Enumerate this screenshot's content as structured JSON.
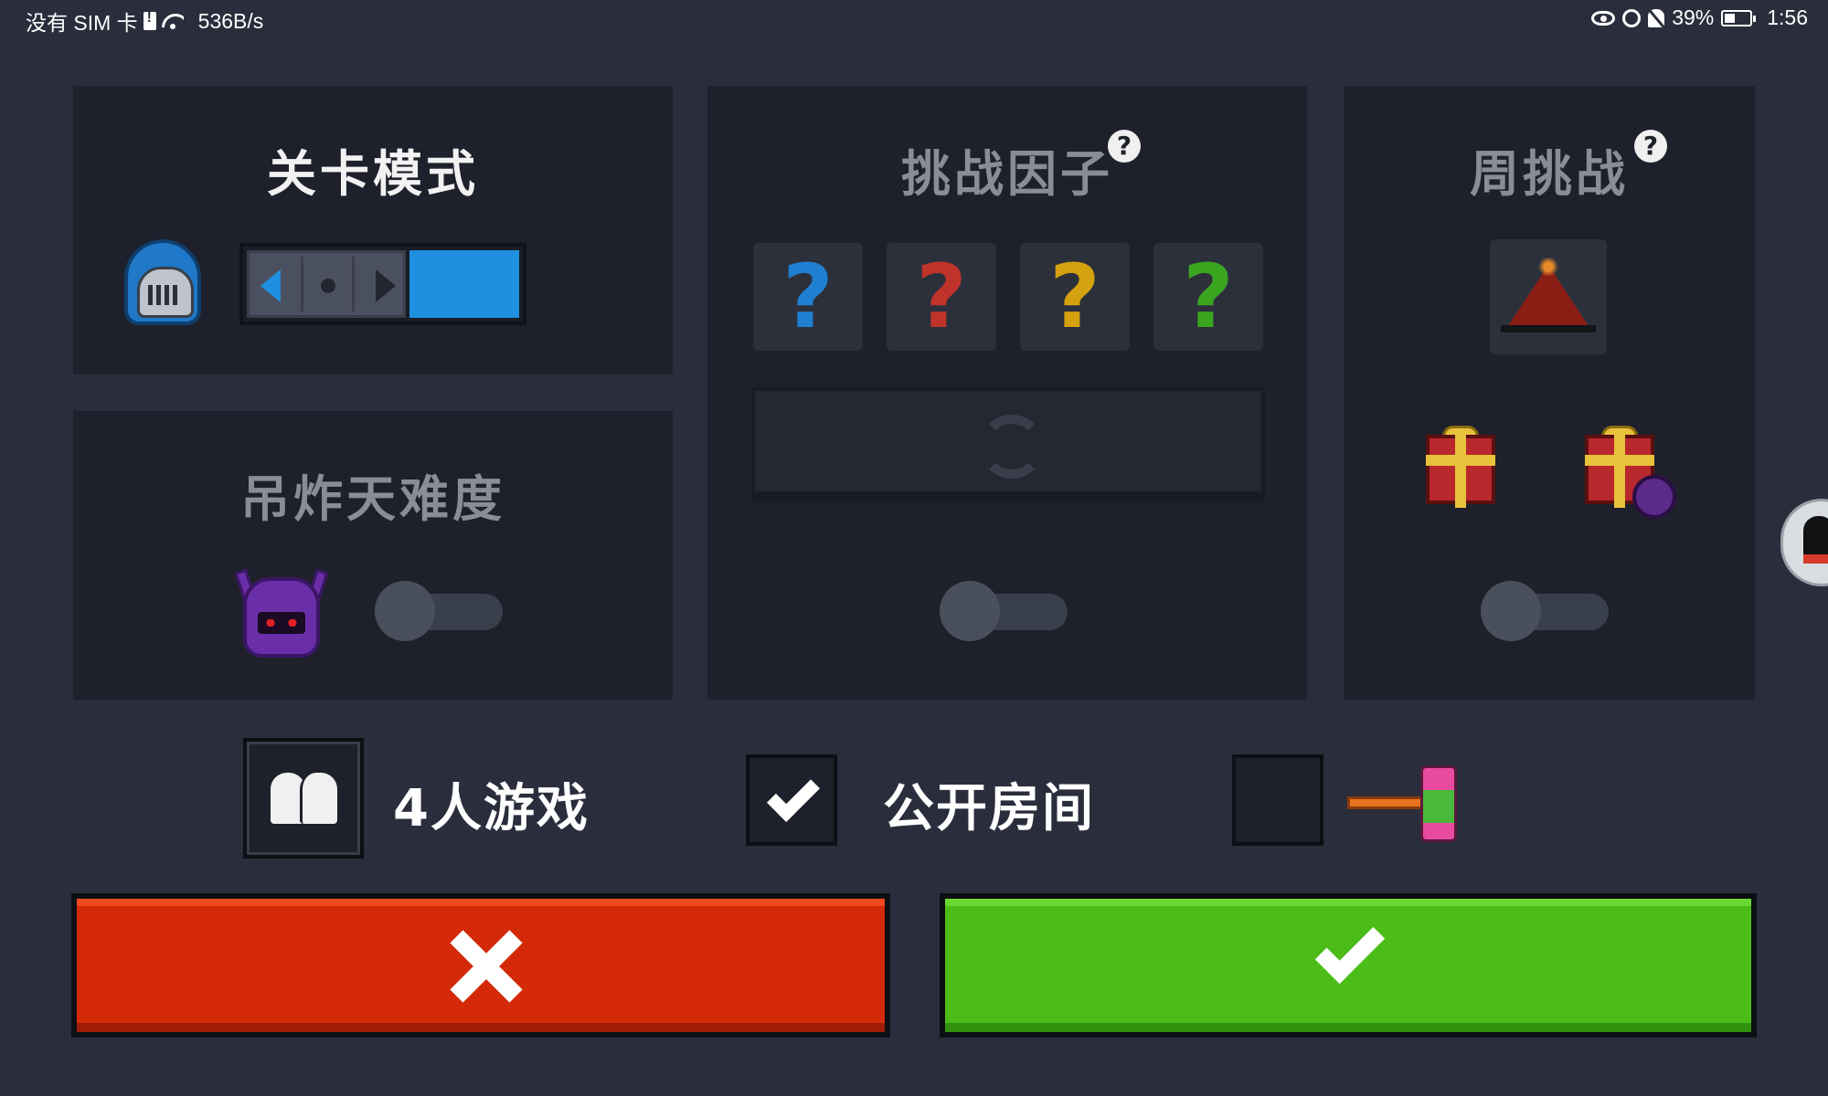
{
  "status_bar": {
    "carrier": "没有 SIM 卡",
    "net_speed": "536B/s",
    "battery": "39%",
    "time": "1:56",
    "icons": [
      "sim-alert-icon",
      "wifi-icon",
      "eye-icon",
      "alarm-icon",
      "bell-off-icon",
      "battery-charging-icon"
    ]
  },
  "level_mode": {
    "title": "关卡模式",
    "icon": "knight-helmet-icon"
  },
  "difficulty": {
    "title": "吊炸天难度",
    "icon": "demon-helmet-icon",
    "enabled": false
  },
  "challenge_factors": {
    "title": "挑战因子",
    "help": "?",
    "slots": [
      {
        "label": "?",
        "color": "#1f7fd0"
      },
      {
        "label": "?",
        "color": "#c0332a"
      },
      {
        "label": "?",
        "color": "#d4a10f"
      },
      {
        "label": "?",
        "color": "#3aa620"
      }
    ],
    "refresh_icon": "refresh-icon",
    "enabled": false
  },
  "weekly_challenge": {
    "title": "周挑战",
    "help": "?",
    "icon": "volcano-icon",
    "rewards": [
      "gift-icon",
      "gift-demon-icon"
    ],
    "enabled": false
  },
  "options": {
    "players_label": "4人游戏",
    "players_icon": "players-icon",
    "public_label": "公开房间",
    "public_checked": true,
    "extra_checked": false,
    "extra_icon": "hammer-icon"
  },
  "actions": {
    "cancel_icon": "close-icon",
    "confirm_icon": "check-icon",
    "cancel_color": "#d42a0a",
    "confirm_color": "#4cbc18"
  }
}
